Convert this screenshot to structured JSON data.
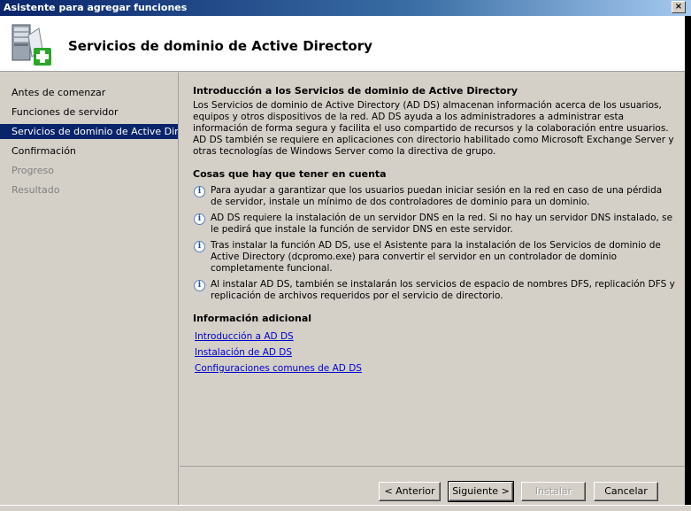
{
  "window": {
    "title": "Asistente para agregar funciones",
    "close_label": "×"
  },
  "header": {
    "title": "Servicios de dominio de Active Directory",
    "icon": "server-add-role-icon"
  },
  "nav": {
    "items": [
      {
        "label": "Antes de comenzar",
        "state": "normal"
      },
      {
        "label": "Funciones de servidor",
        "state": "normal"
      },
      {
        "label": "Servicios de dominio de Active Dir...",
        "state": "active"
      },
      {
        "label": "Confirmación",
        "state": "normal"
      },
      {
        "label": "Progreso",
        "state": "disabled"
      },
      {
        "label": "Resultado",
        "state": "disabled"
      }
    ]
  },
  "main": {
    "intro_heading": "Introducción a los Servicios de dominio de Active Directory",
    "intro_text": "Los Servicios de dominio de Active Directory (AD DS) almacenan información acerca de los usuarios, equipos y otros dispositivos de la red. AD DS ayuda a los administradores a administrar esta información de forma segura y facilita el uso compartido de recursos y la colaboración entre usuarios. AD DS también se requiere en aplicaciones con directorio habilitado como Microsoft Exchange Server y otras tecnologías de Windows Server como la directiva de grupo.",
    "notes_heading": "Cosas que hay que tener en cuenta",
    "notes": [
      "Para ayudar a garantizar que los usuarios puedan iniciar sesión en la red en caso de una pérdida de servidor, instale un mínimo de dos controladores de dominio para un dominio.",
      "AD DS requiere la instalación de un servidor DNS en la red. Si no hay un servidor DNS instalado, se le pedirá que instale la función de servidor DNS en este servidor.",
      "Tras instalar la función AD DS, use el Asistente para la instalación de los Servicios de dominio de Active Directory (dcpromo.exe) para convertir el servidor en un controlador de dominio completamente funcional.",
      "Al instalar AD DS, también se instalarán los servicios de espacio de nombres DFS, replicación DFS y replicación de archivos requeridos por el servicio de directorio."
    ],
    "info_icon": "info-icon",
    "more_heading": "Información adicional",
    "links": [
      "Introducción a AD DS",
      "Instalación de AD DS",
      "Configuraciones comunes de AD DS"
    ]
  },
  "buttons": {
    "back": "< Anterior",
    "next": "Siguiente >",
    "install": "Instalar",
    "cancel": "Cancelar"
  }
}
